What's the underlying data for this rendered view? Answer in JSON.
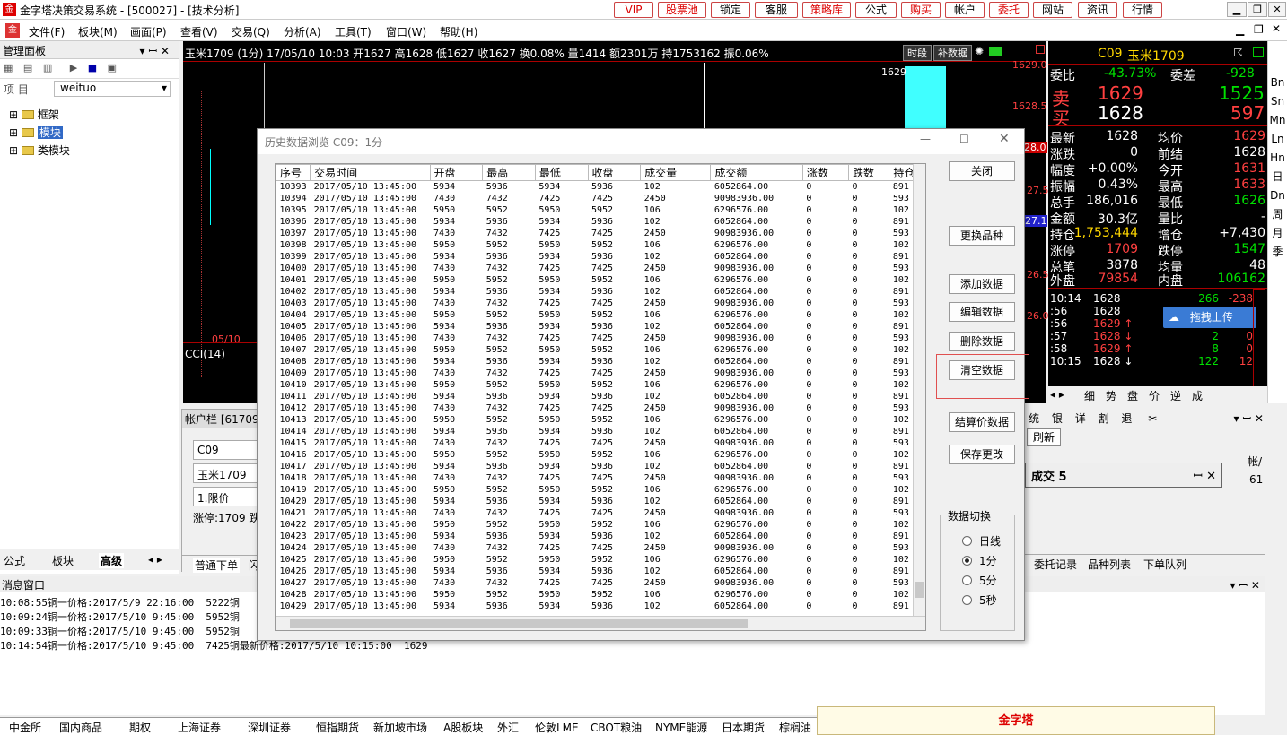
{
  "window": {
    "title": "金字塔决策交易系统 - [500027] - [技术分析]"
  },
  "toolbar_buttons": [
    "VIP",
    "股票池",
    "锁定",
    "客服",
    "策略库",
    "公式",
    "购买",
    "帐户",
    "委托",
    "网站",
    "资讯",
    "行情"
  ],
  "menu": [
    "文件(F)",
    "板块(M)",
    "画面(P)",
    "查看(V)",
    "交易(Q)",
    "分析(A)",
    "工具(T)",
    "窗口(W)",
    "帮助(H)"
  ],
  "panel": {
    "title": "管理面板",
    "field_label": "项 目",
    "field_value": "weituo",
    "tree": [
      "框架",
      "模块",
      "类模块"
    ],
    "tabs": [
      "公式",
      "板块",
      "高级"
    ]
  },
  "chart": {
    "header": "玉米1709 (1分) 17/05/10 10:03 开1627 高1628 低1627 收1627 换0.08% 量1414 额2301万 持1753162 振0.06%",
    "btn_time": "时段",
    "btn_fill": "补数据",
    "price_labels": [
      "1629.0",
      "1628.5",
      "28.0",
      "27.5",
      "27.1",
      "26.5",
      "26.0"
    ],
    "peak_label": "1629",
    "date_label": "05/10",
    "indicator": "CCI(14)"
  },
  "quote": {
    "code": "C09",
    "name": "玉米1709",
    "weibi_label": "委比",
    "weibi": "-43.73%",
    "weicha_label": "委差",
    "weicha": "-928",
    "sell_label": "卖",
    "sell_price": "1629",
    "sell_vol": "1525",
    "buy_label": "买",
    "buy_price": "1628",
    "buy_vol": "597",
    "rows": [
      [
        "最新",
        "1628",
        "均价",
        "1629"
      ],
      [
        "涨跌",
        "0",
        "前结",
        "1628"
      ],
      [
        "幅度",
        "+0.00%",
        "今开",
        "1631"
      ],
      [
        "振幅",
        "0.43%",
        "最高",
        "1633"
      ],
      [
        "总手",
        "186,016",
        "最低",
        "1626"
      ],
      [
        "金额",
        "30.3亿",
        "量比",
        "-"
      ],
      [
        "持仓",
        "1,753,444",
        "增仓",
        "+7,430"
      ],
      [
        "涨停",
        "1709",
        "跌停",
        "1547"
      ],
      [
        "总笔",
        "3878",
        "均量",
        "48"
      ],
      [
        "外盘",
        "79854",
        "内盘",
        "106162"
      ]
    ],
    "ticks": [
      [
        "10:14",
        "1628",
        "266",
        "-238"
      ],
      [
        ":56",
        "1628",
        "",
        ""
      ],
      [
        ":56",
        "1629 ↑",
        "",
        ""
      ],
      [
        ":57",
        "1628 ↓",
        "2",
        "0"
      ],
      [
        ":58",
        "1629 ↑",
        "8",
        "0"
      ],
      [
        "10:15",
        "1628 ↓",
        "122",
        "12"
      ]
    ],
    "bottom_tabs": [
      "细",
      "势",
      "盘",
      "价",
      "逆",
      "成"
    ],
    "upload": "拖拽上传"
  },
  "rightbar": [
    "Bn",
    "Sn",
    "Mn",
    "Ln",
    "Hn",
    "日",
    "Dn",
    "周",
    "月",
    "季"
  ],
  "account": {
    "title": "帐户栏",
    "id": "61709",
    "code": "C09",
    "name": "玉米1709",
    "order_type": "1.限价",
    "limit": "涨停:1709 跌"
  },
  "order_tabs": [
    "普通下单",
    "闪"
  ],
  "right_tabs": [
    "委托记录",
    "品种列表",
    "下单队列"
  ],
  "right_panel": {
    "toolbar": [
      "统",
      "银",
      "详",
      "割",
      "退"
    ],
    "refresh": "刷新",
    "sub_title": "成交 5",
    "col": "帐/",
    "val": "61"
  },
  "dialog": {
    "title": "历史数据浏览 C09：1分",
    "columns": [
      "序号",
      "交易时间",
      "开盘",
      "最高",
      "最低",
      "收盘",
      "成交量",
      "成交额",
      "涨数",
      "跌数",
      "持仓"
    ],
    "rows": [
      [
        "10393",
        "2017/05/10 13:45:00",
        "5934",
        "5936",
        "5934",
        "5936",
        "102",
        "6052864.00",
        "0",
        "0",
        "891"
      ],
      [
        "10394",
        "2017/05/10 13:45:00",
        "7430",
        "7432",
        "7425",
        "7425",
        "2450",
        "90983936.00",
        "0",
        "0",
        "593"
      ],
      [
        "10395",
        "2017/05/10 13:45:00",
        "5950",
        "5952",
        "5950",
        "5952",
        "106",
        "6296576.00",
        "0",
        "0",
        "102"
      ],
      [
        "10396",
        "2017/05/10 13:45:00",
        "5934",
        "5936",
        "5934",
        "5936",
        "102",
        "6052864.00",
        "0",
        "0",
        "891"
      ],
      [
        "10397",
        "2017/05/10 13:45:00",
        "7430",
        "7432",
        "7425",
        "7425",
        "2450",
        "90983936.00",
        "0",
        "0",
        "593"
      ],
      [
        "10398",
        "2017/05/10 13:45:00",
        "5950",
        "5952",
        "5950",
        "5952",
        "106",
        "6296576.00",
        "0",
        "0",
        "102"
      ],
      [
        "10399",
        "2017/05/10 13:45:00",
        "5934",
        "5936",
        "5934",
        "5936",
        "102",
        "6052864.00",
        "0",
        "0",
        "891"
      ],
      [
        "10400",
        "2017/05/10 13:45:00",
        "7430",
        "7432",
        "7425",
        "7425",
        "2450",
        "90983936.00",
        "0",
        "0",
        "593"
      ],
      [
        "10401",
        "2017/05/10 13:45:00",
        "5950",
        "5952",
        "5950",
        "5952",
        "106",
        "6296576.00",
        "0",
        "0",
        "102"
      ],
      [
        "10402",
        "2017/05/10 13:45:00",
        "5934",
        "5936",
        "5934",
        "5936",
        "102",
        "6052864.00",
        "0",
        "0",
        "891"
      ],
      [
        "10403",
        "2017/05/10 13:45:00",
        "7430",
        "7432",
        "7425",
        "7425",
        "2450",
        "90983936.00",
        "0",
        "0",
        "593"
      ],
      [
        "10404",
        "2017/05/10 13:45:00",
        "5950",
        "5952",
        "5950",
        "5952",
        "106",
        "6296576.00",
        "0",
        "0",
        "102"
      ],
      [
        "10405",
        "2017/05/10 13:45:00",
        "5934",
        "5936",
        "5934",
        "5936",
        "102",
        "6052864.00",
        "0",
        "0",
        "891"
      ],
      [
        "10406",
        "2017/05/10 13:45:00",
        "7430",
        "7432",
        "7425",
        "7425",
        "2450",
        "90983936.00",
        "0",
        "0",
        "593"
      ],
      [
        "10407",
        "2017/05/10 13:45:00",
        "5950",
        "5952",
        "5950",
        "5952",
        "106",
        "6296576.00",
        "0",
        "0",
        "102"
      ],
      [
        "10408",
        "2017/05/10 13:45:00",
        "5934",
        "5936",
        "5934",
        "5936",
        "102",
        "6052864.00",
        "0",
        "0",
        "891"
      ],
      [
        "10409",
        "2017/05/10 13:45:00",
        "7430",
        "7432",
        "7425",
        "7425",
        "2450",
        "90983936.00",
        "0",
        "0",
        "593"
      ],
      [
        "10410",
        "2017/05/10 13:45:00",
        "5950",
        "5952",
        "5950",
        "5952",
        "106",
        "6296576.00",
        "0",
        "0",
        "102"
      ],
      [
        "10411",
        "2017/05/10 13:45:00",
        "5934",
        "5936",
        "5934",
        "5936",
        "102",
        "6052864.00",
        "0",
        "0",
        "891"
      ],
      [
        "10412",
        "2017/05/10 13:45:00",
        "7430",
        "7432",
        "7425",
        "7425",
        "2450",
        "90983936.00",
        "0",
        "0",
        "593"
      ],
      [
        "10413",
        "2017/05/10 13:45:00",
        "5950",
        "5952",
        "5950",
        "5952",
        "106",
        "6296576.00",
        "0",
        "0",
        "102"
      ],
      [
        "10414",
        "2017/05/10 13:45:00",
        "5934",
        "5936",
        "5934",
        "5936",
        "102",
        "6052864.00",
        "0",
        "0",
        "891"
      ],
      [
        "10415",
        "2017/05/10 13:45:00",
        "7430",
        "7432",
        "7425",
        "7425",
        "2450",
        "90983936.00",
        "0",
        "0",
        "593"
      ],
      [
        "10416",
        "2017/05/10 13:45:00",
        "5950",
        "5952",
        "5950",
        "5952",
        "106",
        "6296576.00",
        "0",
        "0",
        "102"
      ],
      [
        "10417",
        "2017/05/10 13:45:00",
        "5934",
        "5936",
        "5934",
        "5936",
        "102",
        "6052864.00",
        "0",
        "0",
        "891"
      ],
      [
        "10418",
        "2017/05/10 13:45:00",
        "7430",
        "7432",
        "7425",
        "7425",
        "2450",
        "90983936.00",
        "0",
        "0",
        "593"
      ],
      [
        "10419",
        "2017/05/10 13:45:00",
        "5950",
        "5952",
        "5950",
        "5952",
        "106",
        "6296576.00",
        "0",
        "0",
        "102"
      ],
      [
        "10420",
        "2017/05/10 13:45:00",
        "5934",
        "5936",
        "5934",
        "5936",
        "102",
        "6052864.00",
        "0",
        "0",
        "891"
      ],
      [
        "10421",
        "2017/05/10 13:45:00",
        "7430",
        "7432",
        "7425",
        "7425",
        "2450",
        "90983936.00",
        "0",
        "0",
        "593"
      ],
      [
        "10422",
        "2017/05/10 13:45:00",
        "5950",
        "5952",
        "5950",
        "5952",
        "106",
        "6296576.00",
        "0",
        "0",
        "102"
      ],
      [
        "10423",
        "2017/05/10 13:45:00",
        "5934",
        "5936",
        "5934",
        "5936",
        "102",
        "6052864.00",
        "0",
        "0",
        "891"
      ],
      [
        "10424",
        "2017/05/10 13:45:00",
        "7430",
        "7432",
        "7425",
        "7425",
        "2450",
        "90983936.00",
        "0",
        "0",
        "593"
      ],
      [
        "10425",
        "2017/05/10 13:45:00",
        "5950",
        "5952",
        "5950",
        "5952",
        "106",
        "6296576.00",
        "0",
        "0",
        "102"
      ],
      [
        "10426",
        "2017/05/10 13:45:00",
        "5934",
        "5936",
        "5934",
        "5936",
        "102",
        "6052864.00",
        "0",
        "0",
        "891"
      ],
      [
        "10427",
        "2017/05/10 13:45:00",
        "7430",
        "7432",
        "7425",
        "7425",
        "2450",
        "90983936.00",
        "0",
        "0",
        "593"
      ],
      [
        "10428",
        "2017/05/10 13:45:00",
        "5950",
        "5952",
        "5950",
        "5952",
        "106",
        "6296576.00",
        "0",
        "0",
        "102"
      ],
      [
        "10429",
        "2017/05/10 13:45:00",
        "5934",
        "5936",
        "5934",
        "5936",
        "102",
        "6052864.00",
        "0",
        "0",
        "891"
      ]
    ],
    "buttons": {
      "close": "关闭",
      "change": "更换品种",
      "add": "添加数据",
      "edit": "编辑数据",
      "delete": "删除数据",
      "clear": "清空数据",
      "settle": "结算价数据",
      "save": "保存更改"
    },
    "switch_title": "数据切换",
    "switch_options": [
      "日线",
      "1分",
      "5分",
      "5秒"
    ],
    "switch_selected": "1分"
  },
  "messages": {
    "title": "消息窗口",
    "lines": [
      "10:08:55铜一价格:2017/5/9 22:16:00  5222铜",
      "10:09:24铜一价格:2017/5/10 9:45:00  5952铜",
      "10:09:33铜一价格:2017/5/10 9:45:00  5952铜",
      "10:14:54铜一价格:2017/5/10 9:45:00  7425铜最新价格:2017/5/10 10:15:00  1629"
    ]
  },
  "bottom_tabs": [
    "中金所",
    "国内商品",
    "期权",
    "上海证券",
    "深圳证券",
    "恒指期货",
    "新加坡市场",
    "A股板块",
    "外汇",
    "伦敦LME",
    "CBOT粮油",
    "NYME能源",
    "日本期货",
    "棕榈油"
  ],
  "notice": {
    "title": "金字塔"
  }
}
